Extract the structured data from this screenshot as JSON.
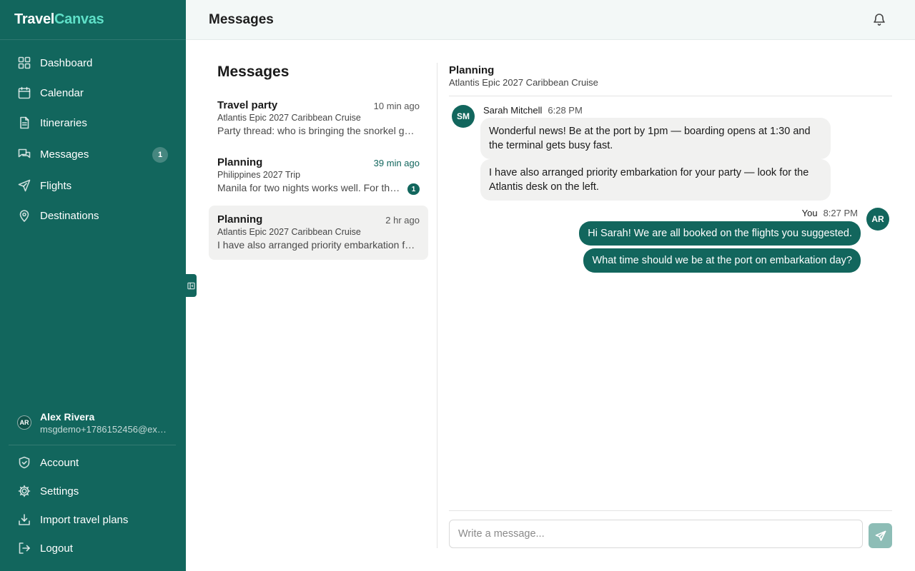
{
  "app": {
    "logo_part1": "Travel",
    "logo_part2": "Canvas",
    "accent_color": "#12665d",
    "logo_accent_color": "#5fe0c8"
  },
  "sidebar": {
    "items": [
      {
        "label": "Dashboard",
        "icon": "dashboard-icon"
      },
      {
        "label": "Calendar",
        "icon": "calendar-icon"
      },
      {
        "label": "Itineraries",
        "icon": "document-icon"
      },
      {
        "label": "Messages",
        "icon": "chat-icon",
        "badge": "1"
      },
      {
        "label": "Flights",
        "icon": "plane-icon"
      },
      {
        "label": "Destinations",
        "icon": "map-pin-icon"
      }
    ],
    "user": {
      "initials": "AR",
      "name": "Alex Rivera",
      "email": "msgdemo+1786152456@exa..."
    },
    "bottom_items": [
      {
        "label": "Account",
        "icon": "shield-icon"
      },
      {
        "label": "Settings",
        "icon": "gear-icon"
      },
      {
        "label": "Import travel plans",
        "icon": "import-icon"
      },
      {
        "label": "Logout",
        "icon": "logout-icon"
      }
    ]
  },
  "header": {
    "title": "Messages",
    "icon": "bell-icon"
  },
  "conversations": {
    "heading": "Messages",
    "items": [
      {
        "title": "Travel party",
        "time": "10 min ago",
        "subtitle": "Atlantis Epic 2027 Caribbean Cruise",
        "preview": "Party thread: who is bringing the snorkel gear for the excursion?"
      },
      {
        "title": "Planning",
        "time": "39 min ago",
        "subtitle": "Philippines 2027 Trip",
        "preview": "Manila for two nights works well. For the rest of the trip",
        "unread": "1"
      },
      {
        "title": "Planning",
        "time": "2 hr ago",
        "subtitle": "Atlantis Epic 2027 Caribbean Cruise",
        "preview": "I have also arranged priority embarkation for your party",
        "active": true
      }
    ]
  },
  "chat": {
    "title": "Planning",
    "subtitle": "Atlantis Epic 2027 Caribbean Cruise",
    "groups": [
      {
        "sender": "Sarah Mitchell",
        "initials": "SM",
        "time": "6:28 PM",
        "direction": "in",
        "messages": [
          "Wonderful news! Be at the port by 1pm — boarding opens at 1:30 and the terminal gets busy fast.",
          "I have also arranged priority embarkation for your party — look for the Atlantis desk on the left."
        ]
      },
      {
        "sender": "You",
        "initials": "AR",
        "time": "8:27 PM",
        "direction": "out",
        "messages": [
          "Hi Sarah! We are all booked on the flights you suggested.",
          "What time should we be at the port on embarkation day?"
        ]
      }
    ],
    "composer": {
      "placeholder": "Write a message...",
      "send_icon": "send-icon"
    }
  }
}
